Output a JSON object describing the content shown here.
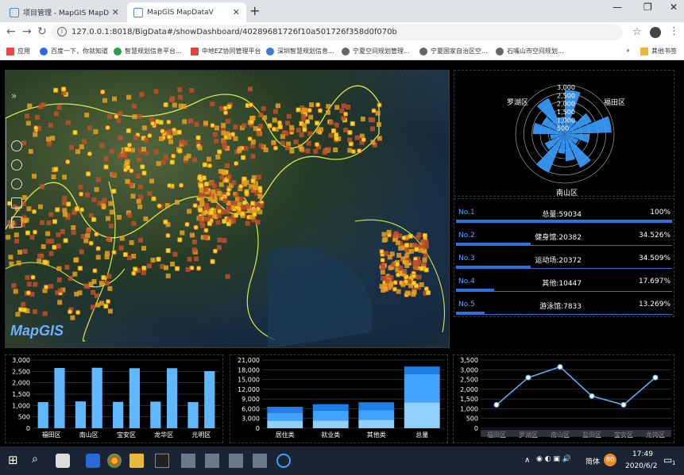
{
  "browser": {
    "tabs": [
      {
        "label": "项目管理 - MapGIS MapDataV",
        "active": false
      },
      {
        "label": "MapGIS MapDataV",
        "active": true
      }
    ],
    "url": "127.0.0.1:8018/BigData#/showDashboard/40289681726f10a501726f358d0f070b",
    "bookmarks": [
      "应用",
      "百度一下，你就知道",
      "智慧规划信息平台...",
      "中地EZ协同管理平台",
      "深圳智慧规划信息...",
      "宁夏空间规划管理...",
      "宁夏国家自治区空...",
      "石嘴山市空间规划..."
    ],
    "other_bookmarks": "其他书签",
    "overflow": "»"
  },
  "map": {
    "logo": "MapGIS",
    "controls": [
      "zoom-in-icon",
      "zoom-out-icon",
      "history-icon",
      "layers-icon",
      "search-icon"
    ]
  },
  "rose_chart": {
    "ring_labels": [
      "3,000",
      "2,500",
      "2,000",
      "1,500",
      "1,000",
      "500"
    ],
    "area_labels": {
      "top_left": "罗湖区",
      "top_right": "福田区",
      "bottom": "南山区"
    },
    "color": "#3aa0ff"
  },
  "ranking": {
    "rows": [
      {
        "no": "No.1",
        "label": "总量:59034",
        "pct": "100%",
        "frac": 1.0
      },
      {
        "no": "No.2",
        "label": "健身馆:20382",
        "pct": "34.526%",
        "frac": 0.34526
      },
      {
        "no": "No.3",
        "label": "运动场:20372",
        "pct": "34.509%",
        "frac": 0.34509
      },
      {
        "no": "No.4",
        "label": "其他:10447",
        "pct": "17.697%",
        "frac": 0.17697
      },
      {
        "no": "No.5",
        "label": "游泳馆:7833",
        "pct": "13.269%",
        "frac": 0.13269
      }
    ],
    "accent": "#2a72e0"
  },
  "chart_data": [
    {
      "type": "bar",
      "title": "",
      "categories": [
        "福田区",
        "南山区",
        "宝安区",
        "龙华区",
        "光明区"
      ],
      "series": [
        {
          "values": [
            1150,
            1180,
            1160,
            1170,
            1150
          ],
          "color": "#5fb8ff"
        },
        {
          "values": [
            2650,
            2660,
            2640,
            2640,
            2510
          ],
          "color": "#5fb8ff"
        }
      ],
      "ylim": [
        0,
        3000
      ],
      "yticks": [
        "3,000",
        "2,500",
        "2,000",
        "1,500",
        "1,000",
        "500",
        "0"
      ]
    },
    {
      "type": "bar",
      "title": "",
      "categories": [
        "居住类",
        "就业类",
        "其他类",
        "总量"
      ],
      "stacked": true,
      "series": [
        {
          "values": [
            2300,
            2400,
            2600,
            8000
          ],
          "color": "#8fd0ff"
        },
        {
          "values": [
            2500,
            3000,
            3000,
            8600
          ],
          "color": "#3fa3ff"
        },
        {
          "values": [
            1800,
            2000,
            2400,
            2400
          ],
          "color": "#1e7fe8"
        }
      ],
      "ylim": [
        0,
        21000
      ],
      "yticks": [
        "21,000",
        "18,000",
        "15,000",
        "12,000",
        "9,000",
        "6,000",
        "3,000",
        "0"
      ]
    },
    {
      "type": "line",
      "title": "",
      "categories": [
        "福田区",
        "罗湖区",
        "南山区",
        "盐田区",
        "宝安区",
        "龙岗区"
      ],
      "values": [
        1200,
        2600,
        3150,
        1650,
        1200,
        2600
      ],
      "ylim": [
        0,
        3500
      ],
      "yticks": [
        "3,500",
        "3,000",
        "2,500",
        "2,000",
        "1,500",
        "1,000",
        "500",
        "0"
      ],
      "color": "#5fb8ff"
    }
  ],
  "taskbar": {
    "ime": "简体",
    "time": "17:49",
    "date": "2020/6/2",
    "badge": "80",
    "notif": "1"
  }
}
